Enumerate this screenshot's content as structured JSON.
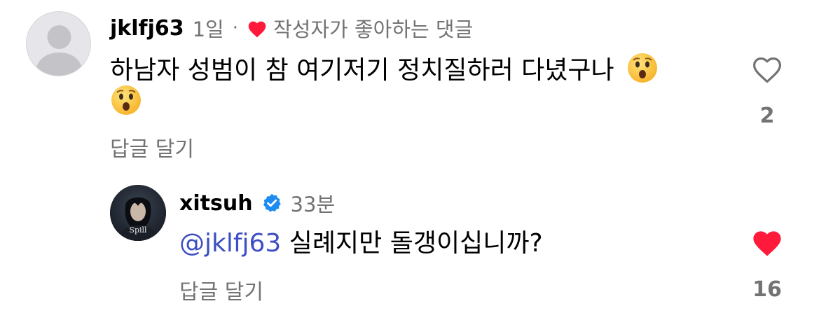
{
  "colors": {
    "text": "#000000",
    "secondary": "#737373",
    "heart_red": "#ff1a3c",
    "mention": "#3d4fc2",
    "verified": "#1d8bf1"
  },
  "comment": {
    "username": "jklfj63",
    "time": "1일",
    "separator": "·",
    "liked_by_author_label": "작성자가 좋아하는 댓글",
    "text": "하남자 성범이 참 여기저기 정치질하러 다녔구나",
    "emoji_1": "😮",
    "emoji_2": "😮",
    "reply_label": "답글 달기",
    "like_count": "2",
    "like_icon": "heart-outline-icon"
  },
  "reply": {
    "username": "xitsuh",
    "verified_icon": "verified-badge-icon",
    "time": "33분",
    "mention": "@jklfj63",
    "text": "실례지만 돌갱이십니까?",
    "avatar_caption": "Spill",
    "reply_label": "답글 달기",
    "like_count": "16",
    "like_icon": "heart-filled-icon"
  }
}
